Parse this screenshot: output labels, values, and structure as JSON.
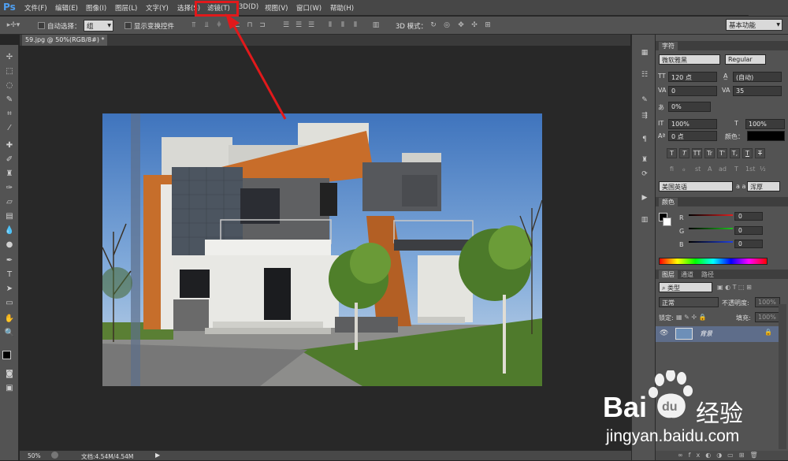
{
  "app": {
    "logo": "Ps"
  },
  "menubar": {
    "items": [
      "文件(F)",
      "编辑(E)",
      "图像(I)",
      "图层(L)",
      "文字(Y)",
      "选择(S)",
      "滤镜(T)",
      "3D(D)",
      "视图(V)",
      "窗口(W)",
      "帮助(H)"
    ]
  },
  "options": {
    "auto_select_label": "自动选择：",
    "auto_select_value": "组",
    "show_transform_label": "显示变换控件",
    "mode_3d_label": "3D 模式：",
    "workspace": "基本功能"
  },
  "document": {
    "tab_title": "59.jpg @ 50%(RGB/8#) *"
  },
  "status": {
    "zoom": "50%",
    "doc_size": "文档:4.54M/4.54M"
  },
  "character_panel": {
    "tab": "字符",
    "font_family": "微软雅黑",
    "font_style": "Regular",
    "font_size": "120 点",
    "leading": "(自动)",
    "kerning": "0",
    "tracking": "35",
    "scale_percent": "0%",
    "vertical_scale": "100%",
    "horizontal_scale": "100%",
    "baseline_shift": "0 点",
    "color_label": "颜色：",
    "language": "美国英语",
    "aa_label": "a a",
    "antialias": "浑厚",
    "style_buttons": [
      "T",
      "T",
      "TT",
      "Tr",
      "T'",
      "T,",
      "T",
      "T"
    ],
    "ot_buttons": [
      "fi",
      "ℴ",
      "st",
      "A",
      "ad",
      "T",
      "1st",
      "½"
    ]
  },
  "color_panel": {
    "tab": "颜色",
    "r_label": "R",
    "r": "0",
    "g_label": "G",
    "g": "0",
    "b_label": "B",
    "b": "0"
  },
  "layers_panel": {
    "tabs": [
      "图层",
      "通道",
      "路径"
    ],
    "filter_kind": "类型",
    "blend_mode": "正常",
    "opacity_label": "不透明度:",
    "opacity": "100%",
    "lock_label": "锁定:",
    "fill_label": "填充:",
    "fill": "100%",
    "layers": [
      {
        "name": "背景"
      }
    ]
  },
  "watermark": {
    "brand": "Bai",
    "brand2": "经验",
    "du": "du",
    "url": "jingyan.baidu.com"
  },
  "colors": {
    "accent_highlight": "#e1191b",
    "ps_blue": "#4f9ff1",
    "layer_selected": "#5e6d8a"
  }
}
